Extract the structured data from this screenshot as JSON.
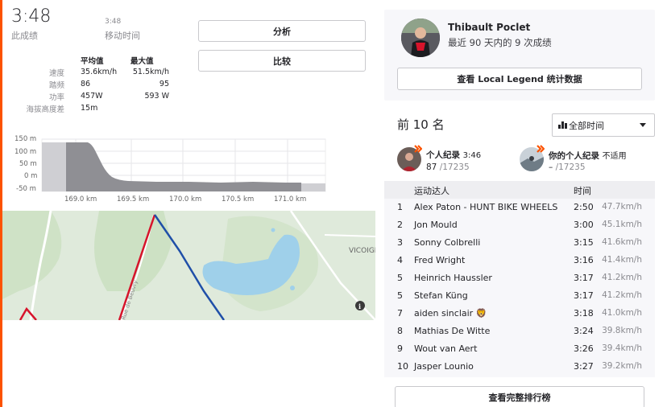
{
  "summary": {
    "elapsed_time": "3:48",
    "elapsed_label": "此成绩",
    "moving_time": "3:48",
    "moving_label": "移动时间"
  },
  "actions": {
    "analyze_label": "分析",
    "compare_label": "比较"
  },
  "stats": {
    "avg_header": "平均值",
    "max_header": "最大值",
    "rows": [
      {
        "label": "速度",
        "avg": "35.6km/h",
        "max": "51.5km/h"
      },
      {
        "label": "踏频",
        "avg": "86",
        "max": "95"
      },
      {
        "label": "功率",
        "avg": "457W",
        "max": "593 W"
      },
      {
        "label": "海拔高度差",
        "avg": "15m",
        "max": ""
      }
    ]
  },
  "elevation_chart": {
    "y_ticks": [
      "150 m",
      "100 m",
      "50 m",
      "0 m",
      "-50 m"
    ],
    "x_ticks": [
      "169.0 km",
      "169.5 km",
      "170.0 km",
      "170.5 km",
      "171.0 km"
    ],
    "fill_color": "#8f8f94",
    "highlight_color": "#cfcfd3"
  },
  "map": {
    "route_colors": {
      "inbound": "#d7142b",
      "outbound": "#1f4fa8"
    },
    "place_label": "VICOIGN",
    "road_label": "Rue de Beuvry",
    "info_icon": "info-icon"
  },
  "local_legend": {
    "name": "Thibault Poclet",
    "subtitle": "最近 90 天内的 9 次成绩",
    "button_label": "查看 Local Legend 统计数据"
  },
  "leaderboard": {
    "title": "前 10 名",
    "filter_label": "全部时间",
    "personal_record": {
      "title": "个人纪录",
      "time": "3:46",
      "rank": "87",
      "total": "/17235"
    },
    "your_record": {
      "title": "你的个人纪录",
      "status": "不适用",
      "rank": "–",
      "total": "/17235"
    },
    "col_athlete": "运动达人",
    "col_time": "时间",
    "rows": [
      {
        "rank": "1",
        "name": "Alex Paton - HUNT BIKE WHEELS",
        "time": "2:50",
        "speed": "47.7km/h"
      },
      {
        "rank": "2",
        "name": "Jon Mould",
        "time": "3:00",
        "speed": "45.1km/h"
      },
      {
        "rank": "3",
        "name": "Sonny Colbrelli",
        "time": "3:15",
        "speed": "41.6km/h"
      },
      {
        "rank": "4",
        "name": "Fred Wright",
        "time": "3:16",
        "speed": "41.4km/h"
      },
      {
        "rank": "5",
        "name": "Heinrich Haussler",
        "time": "3:17",
        "speed": "41.2km/h"
      },
      {
        "rank": "5",
        "name": "Stefan Küng",
        "time": "3:17",
        "speed": "41.2km/h"
      },
      {
        "rank": "7",
        "name": "aiden sinclair 🦁",
        "time": "3:18",
        "speed": "41.0km/h"
      },
      {
        "rank": "8",
        "name": "Mathias De Witte",
        "time": "3:24",
        "speed": "39.8km/h"
      },
      {
        "rank": "9",
        "name": "Wout van Aert",
        "time": "3:26",
        "speed": "39.4km/h"
      },
      {
        "rank": "10",
        "name": "Jasper Lounio",
        "time": "3:27",
        "speed": "39.2km/h"
      }
    ],
    "full_button_label": "查看完整排行榜"
  },
  "colors": {
    "accent": "#fc5200",
    "panel_bg": "#f7f7fa"
  }
}
